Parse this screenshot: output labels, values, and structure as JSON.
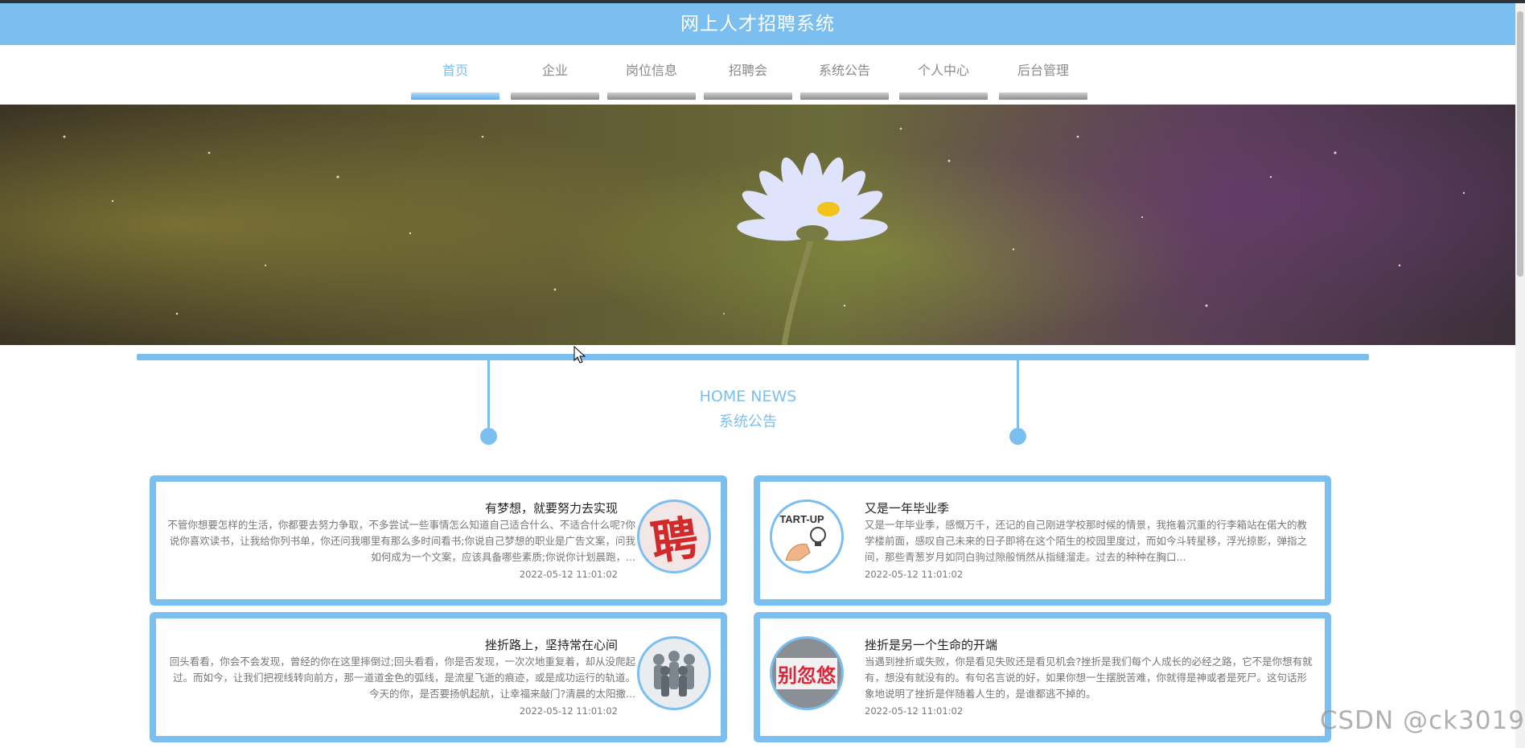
{
  "header": {
    "title": "网上人才招聘系统"
  },
  "nav": {
    "items": [
      {
        "label": "首页",
        "active": true
      },
      {
        "label": "企业"
      },
      {
        "label": "岗位信息"
      },
      {
        "label": "招聘会"
      },
      {
        "label": "系统公告"
      },
      {
        "label": "个人中心"
      },
      {
        "label": "后台管理"
      }
    ]
  },
  "news": {
    "title_en": "HOME NEWS",
    "title_cn": "系统公告",
    "items": [
      {
        "title": "有梦想，就要努力去实现",
        "excerpt": "不管你想要怎样的生活，你都要去努力争取，不多尝试一些事情怎么知道自己适合什么、不适合什么呢?你说你喜欢读书，让我给你列书单，你还问我哪里有那么多时间看书;你说自己梦想的职业是广告文案，问我如何成为一个文案，应该具备哪些素质;你说你计划晨跑，...",
        "date": "2022-05-12 11:01:02",
        "thumb_icon": "hire-poster-icon",
        "thumb_text": "聘"
      },
      {
        "title": "又是一年毕业季",
        "excerpt": "又是一年毕业季，感慨万千，还记的自己刚进学校那时候的情景，我拖着沉重的行李箱站在偌大的教学楼前面，感叹自己未来的日子即将在这个陌生的校园里度过，而如今斗转星移，浮光掠影，弹指之间，那些青葱岁月如同白驹过隙般悄然从指缝溜走。过去的种种在胸口...",
        "date": "2022-05-12 11:01:02",
        "thumb_icon": "startup-lightbulb-icon",
        "thumb_text": "TART-UP"
      },
      {
        "title": "挫折路上，坚持常在心间",
        "excerpt": "回头看看，你会不会发现，曾经的你在这里摔倒过;回头看看，你是否发现，一次次地重复着，却从没爬起过。而如今，让我们把视线转向前方，那一道道金色的弧线，是流星飞逝的痕迹，或是成功运行的轨道。今天的你，是否要扬帆起航，让幸福来敲门?清晨的太阳撒...",
        "date": "2022-05-12 11:01:02",
        "thumb_icon": "team-figures-icon",
        "thumb_text": ""
      },
      {
        "title": "挫折是另一个生命的开端",
        "excerpt": "当遇到挫折或失败，你是看见失败还是看见机会?挫折是我们每个人成长的必经之路，它不是你想有就有，想没有就没有的。有句名言说的好，如果你想一生摆脱苦难，你就得是神或者是死尸。这句话形象地说明了挫折是伴随着人生的，是谁都逃不掉的。",
        "date": "2022-05-12 11:01:02",
        "thumb_icon": "slogan-poster-icon",
        "thumb_text": "别忽悠"
      }
    ]
  },
  "watermark": {
    "text": "CSDN @ck3019"
  },
  "colors": {
    "accent": "#7bbff1",
    "text": "#222222",
    "muted": "#777777"
  }
}
